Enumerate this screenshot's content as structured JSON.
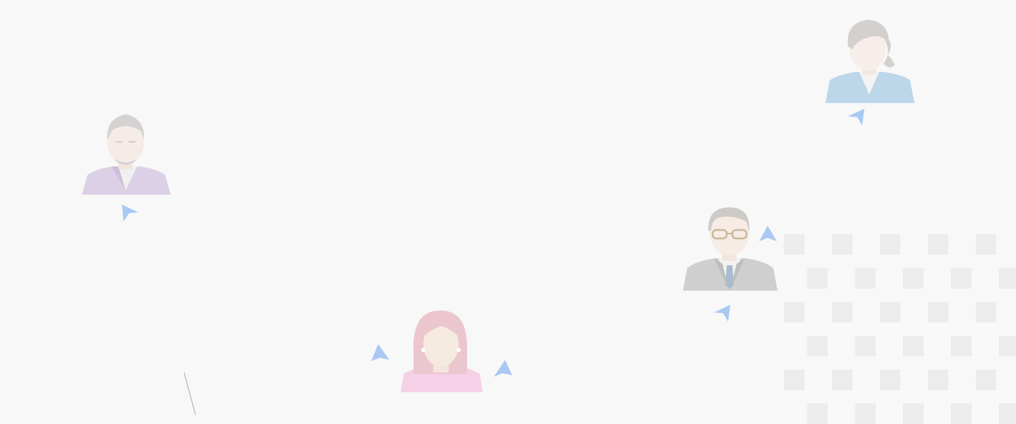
{
  "illustration": {
    "avatars": [
      {
        "icon": "man-beard-avatar",
        "shirt_color": "#dcd0e6",
        "hair_color": "#d5d3d2"
      },
      {
        "icon": "woman-ponytail-avatar",
        "shirt_color": "#bcd6ea",
        "hair_color": "#d3d0cd"
      },
      {
        "icon": "businessman-glasses-avatar",
        "shirt_color": "#cfcfcf",
        "hair_color": "#cdcac7"
      },
      {
        "icon": "woman-pink-hair-avatar",
        "shirt_color": "#f6d0e6",
        "hair_color": "#ecc6cf"
      }
    ],
    "pointer_color": "#a9c8f4",
    "grid_color": "#ececec",
    "background_color": "#f8f8f8"
  }
}
